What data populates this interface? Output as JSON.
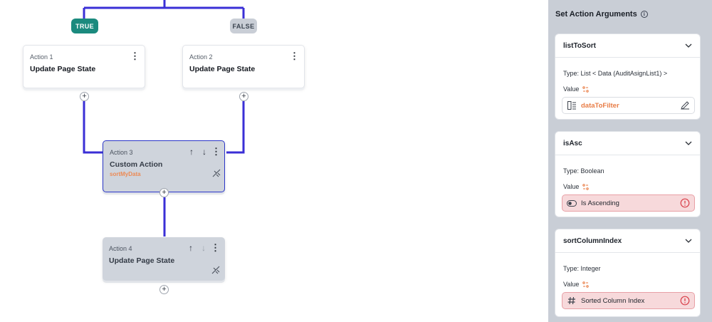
{
  "flow": {
    "branches": {
      "true_label": "TRUE",
      "false_label": "FALSE"
    },
    "nodes": [
      {
        "label": "Action 1",
        "title": "Update Page State"
      },
      {
        "label": "Action 2",
        "title": "Update Page State"
      },
      {
        "label": "Action 3",
        "title": "Custom Action",
        "subtitle": "sortMyData",
        "selected": true
      },
      {
        "label": "Action 4",
        "title": "Update Page State"
      }
    ],
    "add_glyph": "+",
    "menu_glyph": "⋮",
    "move_up_glyph": "↑",
    "move_down_glyph": "↓",
    "colors": {
      "wire": "#3a2fd6",
      "true_badge": "#1b8a7e",
      "false_badge": "#c9ced6",
      "selected_border": "#2b36c9"
    }
  },
  "panel": {
    "title": "Set Action Arguments",
    "arguments": [
      {
        "name": "listToSort",
        "type": "Type: List < Data (AuditAsignList1) >",
        "value_label": "Value",
        "value": "dataToFilter",
        "state": "set",
        "value_icon": "document-list-icon"
      },
      {
        "name": "isAsc",
        "type": "Type: Boolean",
        "value_label": "Value",
        "value": "Is Ascending",
        "state": "error",
        "value_icon": "toggle-icon"
      },
      {
        "name": "sortColumnIndex",
        "type": "Type: Integer",
        "value_label": "Value",
        "value": "Sorted Column Index",
        "state": "error",
        "value_icon": "hash-icon"
      }
    ],
    "colors": {
      "panel_bg": "#c9ced6",
      "error_bg": "#f7d9db",
      "error_icon": "#d9404b",
      "value_text": "#e87c45"
    }
  }
}
